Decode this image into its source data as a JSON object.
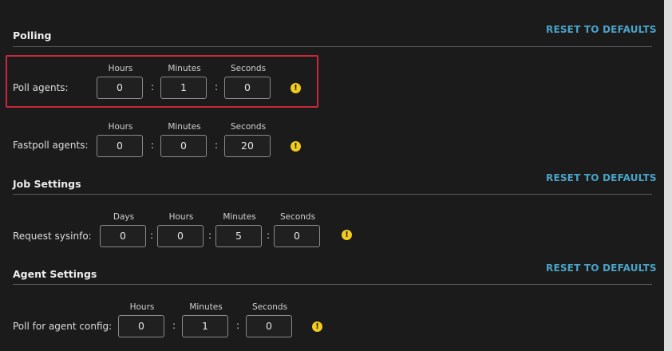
{
  "polling": {
    "title": "Polling",
    "reset_label": "RESET TO DEFAULTS",
    "rows": [
      {
        "label": "Poll agents:",
        "units": [
          "Hours",
          "Minutes",
          "Seconds"
        ],
        "values": [
          "0",
          "1",
          "0"
        ]
      },
      {
        "label": "Fastpoll agents:",
        "units": [
          "Hours",
          "Minutes",
          "Seconds"
        ],
        "values": [
          "0",
          "0",
          "20"
        ]
      }
    ]
  },
  "job_settings": {
    "title": "Job Settings",
    "reset_label": "RESET TO DEFAULTS",
    "rows": [
      {
        "label": "Request sysinfo:",
        "units": [
          "Days",
          "Hours",
          "Minutes",
          "Seconds"
        ],
        "values": [
          "0",
          "0",
          "5",
          "0"
        ]
      }
    ]
  },
  "agent_settings": {
    "title": "Agent Settings",
    "reset_label": "RESET TO DEFAULTS",
    "rows": [
      {
        "label": "Poll for agent config:",
        "units": [
          "Hours",
          "Minutes",
          "Seconds"
        ],
        "values": [
          "0",
          "1",
          "0"
        ]
      }
    ]
  },
  "separator_char": ":",
  "warning_glyph": "!",
  "icons": {
    "warning": "warning-icon"
  },
  "colors": {
    "accent": "#4aa3c7",
    "warning": "#f2cc1d",
    "highlight": "#c8283c",
    "background": "#1b1b1b"
  }
}
